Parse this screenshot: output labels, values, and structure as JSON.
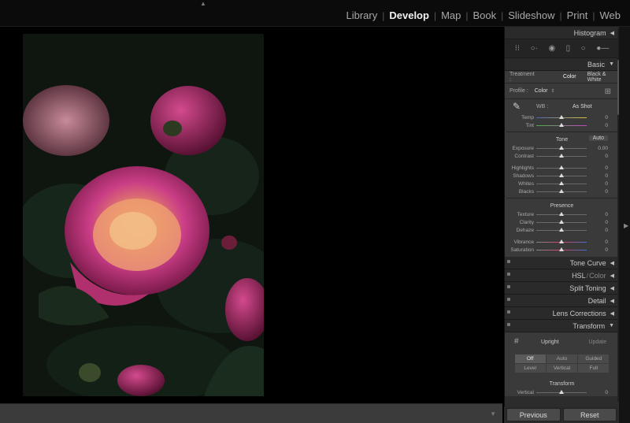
{
  "modules": [
    "Library",
    "Develop",
    "Map",
    "Book",
    "Slideshow",
    "Print",
    "Web"
  ],
  "active_module": "Develop",
  "panels": {
    "histogram": "Histogram",
    "basic": "Basic",
    "tone_curve": "Tone Curve",
    "hsl": "HSL",
    "hsl_color": "Color",
    "split_toning": "Split Toning",
    "detail": "Detail",
    "lens_corrections": "Lens Corrections",
    "transform": "Transform"
  },
  "basic": {
    "treatment_label": "Treatment :",
    "treatment_color": "Color",
    "treatment_bw": "Black & White",
    "profile_label": "Profile :",
    "profile_value": "Color",
    "wb_label": "WB :",
    "wb_value": "As Shot",
    "tone_label": "Tone",
    "auto_label": "Auto",
    "presence_label": "Presence",
    "sliders_wb": [
      {
        "label": "Temp",
        "value": "0",
        "pos": 0.5
      },
      {
        "label": "Tint",
        "value": "0",
        "pos": 0.5
      }
    ],
    "sliders_tone1": [
      {
        "label": "Exposure",
        "value": "0.00",
        "pos": 0.5
      },
      {
        "label": "Contrast",
        "value": "0",
        "pos": 0.5
      }
    ],
    "sliders_tone2": [
      {
        "label": "Highlights",
        "value": "0",
        "pos": 0.5
      },
      {
        "label": "Shadows",
        "value": "0",
        "pos": 0.5
      },
      {
        "label": "Whites",
        "value": "0",
        "pos": 0.5
      },
      {
        "label": "Blacks",
        "value": "0",
        "pos": 0.5
      }
    ],
    "sliders_presence1": [
      {
        "label": "Texture",
        "value": "0",
        "pos": 0.5
      },
      {
        "label": "Clarity",
        "value": "0",
        "pos": 0.5
      },
      {
        "label": "Dehaze",
        "value": "0",
        "pos": 0.5
      }
    ],
    "sliders_presence2": [
      {
        "label": "Vibrance",
        "value": "0",
        "pos": 0.5
      },
      {
        "label": "Saturation",
        "value": "0",
        "pos": 0.5
      }
    ]
  },
  "transform": {
    "upright_label": "Upright",
    "update_label": "Update",
    "buttons": [
      "Off",
      "Auto",
      "Guided",
      "Level",
      "Vertical",
      "Full"
    ],
    "transform_label": "Transform",
    "vertical_label": "Vertical",
    "vertical_value": "0"
  },
  "footer": {
    "previous": "Previous",
    "reset": "Reset"
  }
}
